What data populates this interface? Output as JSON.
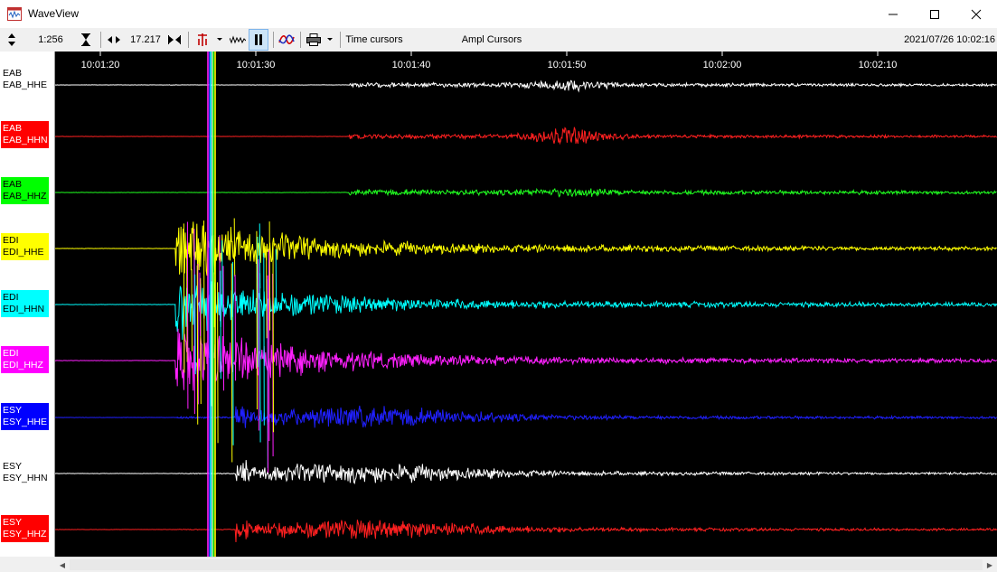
{
  "window": {
    "title": "WaveView"
  },
  "toolbar": {
    "scale_value": "1:256",
    "time_value": "17.217",
    "time_cursors_label": "Time cursors",
    "ampl_cursors_label": "Ampl Cursors",
    "datetime": "2021/07/26 10:02:16"
  },
  "time_axis": {
    "ticks": [
      "10:01:20",
      "10:01:30",
      "10:01:40",
      "10:01:50",
      "10:02:00",
      "10:02:10"
    ]
  },
  "channels": [
    {
      "station": "EAB",
      "name": "EAB_HHE",
      "color": "#ffffff",
      "label_bg": "#ffffff",
      "label_fg": "#000000"
    },
    {
      "station": "EAB",
      "name": "EAB_HHN",
      "color": "#ff2020",
      "label_bg": "#ff0000",
      "label_fg": "#ffffff"
    },
    {
      "station": "EAB",
      "name": "EAB_HHZ",
      "color": "#20ff20",
      "label_bg": "#00ff00",
      "label_fg": "#000000"
    },
    {
      "station": "EDI",
      "name": "EDI_HHE",
      "color": "#ffff00",
      "label_bg": "#ffff00",
      "label_fg": "#000000"
    },
    {
      "station": "EDI",
      "name": "EDI_HHN",
      "color": "#00ffff",
      "label_bg": "#00ffff",
      "label_fg": "#000000"
    },
    {
      "station": "EDI",
      "name": "EDI_HHZ",
      "color": "#ff20ff",
      "label_bg": "#ff00ff",
      "label_fg": "#ffffff"
    },
    {
      "station": "ESY",
      "name": "ESY_HHE",
      "color": "#2020ff",
      "label_bg": "#0000ff",
      "label_fg": "#ffffff"
    },
    {
      "station": "ESY",
      "name": "ESY_HHN",
      "color": "#ffffff",
      "label_bg": "#ffffff",
      "label_fg": "#000000"
    },
    {
      "station": "ESY",
      "name": "ESY_HHZ",
      "color": "#ff2020",
      "label_bg": "#ff0000",
      "label_fg": "#ffffff"
    }
  ]
}
